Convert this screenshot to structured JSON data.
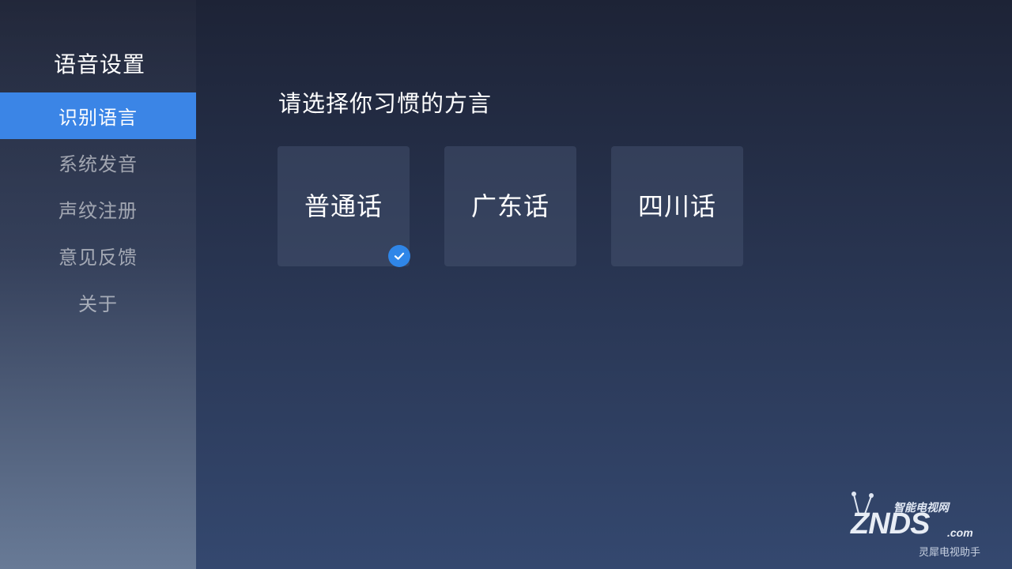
{
  "sidebar": {
    "title": "语音设置",
    "items": [
      {
        "label": "识别语言",
        "active": true
      },
      {
        "label": "系统发音",
        "active": false
      },
      {
        "label": "声纹注册",
        "active": false
      },
      {
        "label": "意见反馈",
        "active": false
      },
      {
        "label": "关于",
        "active": false
      }
    ]
  },
  "main": {
    "heading": "请选择你习惯的方言",
    "options": [
      {
        "label": "普通话",
        "selected": true
      },
      {
        "label": "广东话",
        "selected": false
      },
      {
        "label": "四川话",
        "selected": false
      }
    ]
  },
  "watermark": {
    "site_name_cn": "智能电视网",
    "logo_text": "ZNDS",
    "logo_suffix": ".com",
    "subtitle": "灵犀电视助手"
  },
  "colors": {
    "accent": "#3b85e6",
    "check": "#2f86e8"
  },
  "icons": {
    "selected_indicator": "check-circle-icon",
    "watermark_antenna": "tv-antenna-icon"
  }
}
